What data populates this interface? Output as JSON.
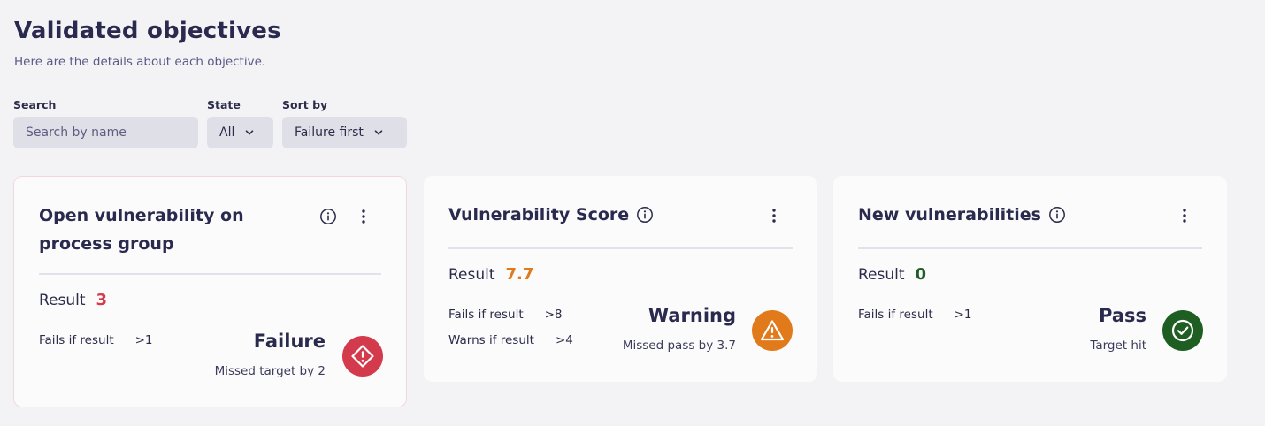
{
  "header": {
    "title": "Validated objectives",
    "subtitle": "Here are the details about each objective."
  },
  "filters": {
    "search": {
      "label": "Search",
      "placeholder": "Search by name",
      "value": ""
    },
    "state": {
      "label": "State",
      "value": "All"
    },
    "sort": {
      "label": "Sort by",
      "value": "Failure first"
    }
  },
  "colors": {
    "failure": "#d33a4b",
    "warning": "#e07a1b",
    "pass": "#1f5e22",
    "background": "#f3f3f6",
    "card": "#fbfbfc"
  },
  "cards": [
    {
      "title_line1": "Open vulnerability on",
      "title_line2": "process group",
      "result_label": "Result",
      "result_value": "3",
      "criteria": [
        {
          "label": "Fails if result",
          "value": ">1"
        }
      ],
      "status": "Failure",
      "status_description": "Missed target by 2",
      "status_icon": "failure-diamond-icon"
    },
    {
      "title": "Vulnerability Score",
      "result_label": "Result",
      "result_value": "7.7",
      "criteria": [
        {
          "label": "Fails if result",
          "value": ">8"
        },
        {
          "label": "Warns if result",
          "value": ">4"
        }
      ],
      "status": "Warning",
      "status_description": "Missed pass by 3.7",
      "status_icon": "warning-triangle-icon"
    },
    {
      "title": "New vulnerabilities",
      "result_label": "Result",
      "result_value": "0",
      "criteria": [
        {
          "label": "Fails if result",
          "value": ">1"
        }
      ],
      "status": "Pass",
      "status_description": "Target hit",
      "status_icon": "pass-check-icon"
    }
  ]
}
